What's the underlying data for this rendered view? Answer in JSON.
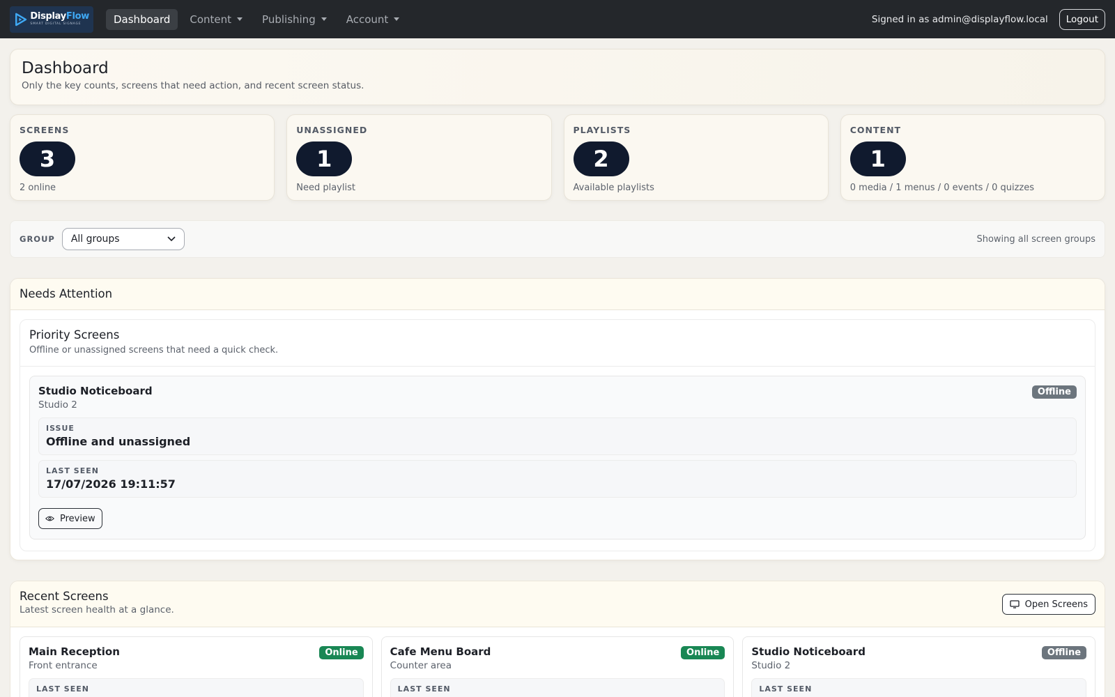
{
  "brand": {
    "name_part1": "Display",
    "name_part2": "Flow",
    "tagline": "SMART DIGITAL SIGNAGE"
  },
  "nav": [
    {
      "label": "Dashboard",
      "active": true,
      "dropdown": false
    },
    {
      "label": "Content",
      "active": false,
      "dropdown": true
    },
    {
      "label": "Publishing",
      "active": false,
      "dropdown": true
    },
    {
      "label": "Account",
      "active": false,
      "dropdown": true
    }
  ],
  "header": {
    "signed_in": "Signed in as admin@displayflow.local",
    "logout": "Logout"
  },
  "hero": {
    "title": "Dashboard",
    "subtitle": "Only the key counts, screens that need action, and recent screen status."
  },
  "stats": [
    {
      "label": "SCREENS",
      "value": "3",
      "sub": "2 online"
    },
    {
      "label": "UNASSIGNED",
      "value": "1",
      "sub": "Need playlist"
    },
    {
      "label": "PLAYLISTS",
      "value": "2",
      "sub": "Available playlists"
    },
    {
      "label": "CONTENT",
      "value": "1",
      "sub": "0 media / 1 menus / 0 events / 0 quizzes"
    }
  ],
  "filter": {
    "label": "GROUP",
    "selected": "All groups",
    "note": "Showing all screen groups"
  },
  "attention": {
    "title": "Needs Attention",
    "priority_title": "Priority Screens",
    "priority_subtitle": "Offline or unassigned screens that need a quick check.",
    "screen": {
      "name": "Studio Noticeboard",
      "location": "Studio 2",
      "status": "Offline",
      "issue_label": "ISSUE",
      "issue": "Offline and unassigned",
      "last_seen_label": "LAST SEEN",
      "last_seen": "17/07/2026 19:11:57",
      "preview": "Preview"
    }
  },
  "recent": {
    "title": "Recent Screens",
    "subtitle": "Latest screen health at a glance.",
    "open_button": "Open Screens",
    "screens": [
      {
        "name": "Main Reception",
        "location": "Front entrance",
        "status": "Online",
        "last_seen_label": "LAST SEEN"
      },
      {
        "name": "Cafe Menu Board",
        "location": "Counter area",
        "status": "Online",
        "last_seen_label": "LAST SEEN"
      },
      {
        "name": "Studio Noticeboard",
        "location": "Studio 2",
        "status": "Offline",
        "last_seen_label": "LAST SEEN"
      }
    ]
  },
  "colors": {
    "navbar": "#24272b",
    "pill": "#101a2e",
    "online": "#198754",
    "offline": "#6c757d",
    "accent": "#3fa9f5"
  },
  "icons": {
    "brand": "play-logo-icon",
    "caret": "caret-down-icon",
    "select": "chevron-down-icon",
    "preview": "eye-icon",
    "open": "monitor-icon"
  }
}
